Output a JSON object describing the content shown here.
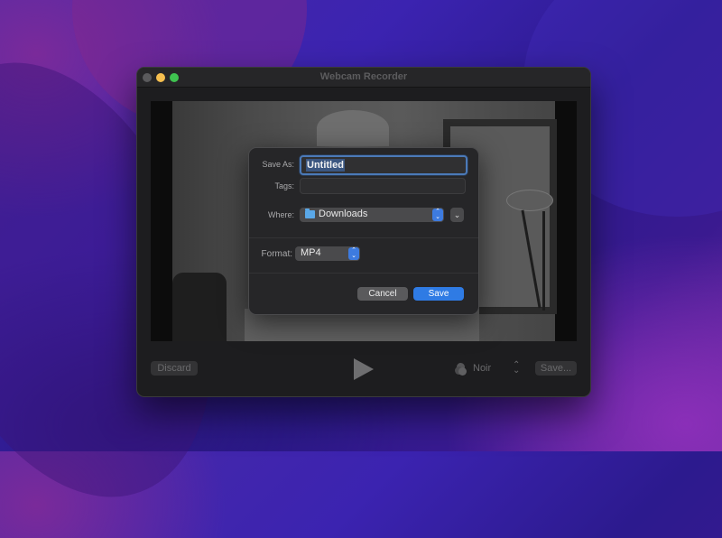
{
  "window": {
    "title": "Webcam Recorder",
    "traffic_lights": [
      "close",
      "minimize",
      "zoom"
    ]
  },
  "controls": {
    "discard_label": "Discard",
    "play_icon": "play-icon",
    "filter_icon": "color-filter-icon",
    "filter_value": "Noir",
    "filter_stepper_icon": "stepper-icon",
    "save_label": "Save..."
  },
  "save_sheet": {
    "save_as_label": "Save As:",
    "save_as_value": "Untitled",
    "tags_label": "Tags:",
    "tags_value": "",
    "where_label": "Where:",
    "where_icon": "folder-icon",
    "where_value": "Downloads",
    "expand_icon": "chevron-down-icon",
    "format_label": "Format:",
    "format_value": "MP4",
    "cancel_label": "Cancel",
    "save_label": "Save",
    "accent_color": "#2f7be4"
  }
}
